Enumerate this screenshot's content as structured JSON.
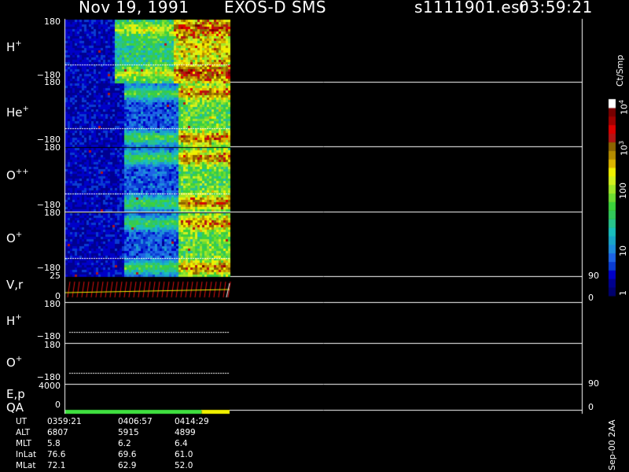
{
  "header": {
    "date": "Nov 19, 1991",
    "instrument": "EXOS-D SMS",
    "file": "s1111901.esr",
    "time": "03:59:21"
  },
  "colorbar": {
    "unit": "Ct/Smp",
    "labels": [
      {
        "text": "1",
        "y": 368
      },
      {
        "text": "10",
        "y": 318
      },
      {
        "text": "100",
        "y": 245
      },
      {
        "text": "10",
        "sup": "3",
        "y": 190
      },
      {
        "text": "10",
        "sup": "4",
        "y": 138
      }
    ],
    "colors": [
      "#00006e",
      "#000090",
      "#0000c8",
      "#0a3cd2",
      "#1e64e6",
      "#1e8cdc",
      "#19a5c8",
      "#19bebe",
      "#28c38c",
      "#32c85a",
      "#3cd23c",
      "#6edc32",
      "#a0e628",
      "#d2f01e",
      "#f0f000",
      "#dcb400",
      "#b48c00",
      "#8c6400",
      "#b41414",
      "#dc0000",
      "#a00000",
      "#780000",
      "#ffffff"
    ]
  },
  "chart_data": [
    {
      "type": "heatmap",
      "panel": "H+",
      "species": "H",
      "charge": "+",
      "ylim": [
        -180,
        180
      ],
      "tick_top": "180",
      "tick_bottom": "−180"
    },
    {
      "type": "heatmap",
      "panel": "He+",
      "species": "He",
      "charge": "+",
      "ylim": [
        -180,
        180
      ],
      "tick_top": "180",
      "tick_bottom": "−180"
    },
    {
      "type": "heatmap",
      "panel": "O++",
      "species": "O",
      "charge": "++",
      "ylim": [
        -180,
        180
      ],
      "tick_top": "180",
      "tick_bottom": "−180"
    },
    {
      "type": "heatmap",
      "panel": "O+",
      "species": "O",
      "charge": "+",
      "ylim": [
        -180,
        180
      ],
      "tick_top": "180",
      "tick_bottom": "−180"
    },
    {
      "type": "line",
      "panel": "V,r",
      "label": "V,r",
      "ylim": [
        0,
        25
      ],
      "tick_top": "25",
      "tick_bottom": "0",
      "right_ticks": [
        "90",
        "0"
      ]
    },
    {
      "type": "line",
      "panel": "H+ (lower)",
      "species": "H",
      "charge": "+",
      "ylim": [
        -180,
        180
      ],
      "tick_top": "180",
      "tick_bottom": "−180"
    },
    {
      "type": "line",
      "panel": "O+ (lower)",
      "species": "O",
      "charge": "+",
      "ylim": [
        -180,
        180
      ],
      "tick_top": "180",
      "tick_bottom": "−180"
    },
    {
      "type": "line",
      "panel": "E,p",
      "label": "E,p",
      "ylim": [
        0,
        4000
      ],
      "tick_top": "4000",
      "tick_bottom": "0",
      "right_ticks": [
        "90",
        "0"
      ]
    },
    {
      "type": "bar",
      "panel": "QA",
      "label": "QA",
      "segments": [
        {
          "from": 0,
          "to": 0.83,
          "color": "#40e040"
        },
        {
          "from": 0.83,
          "to": 1.0,
          "color": "#f0f000"
        }
      ]
    }
  ],
  "axis_table": {
    "rows": [
      {
        "name": "UT",
        "values": [
          "0359:21",
          "0406:57",
          "0414:29"
        ]
      },
      {
        "name": "ALT",
        "values": [
          "6807",
          "5915",
          "4899"
        ]
      },
      {
        "name": "MLT",
        "values": [
          "5.8",
          "6.2",
          "6.4"
        ]
      },
      {
        "name": "InLat",
        "values": [
          "76.6",
          "69.6",
          "61.0"
        ]
      },
      {
        "name": "MLat",
        "values": [
          "72.1",
          "62.9",
          "52.0"
        ]
      }
    ]
  },
  "footer_note": "Sep-00 2AA"
}
